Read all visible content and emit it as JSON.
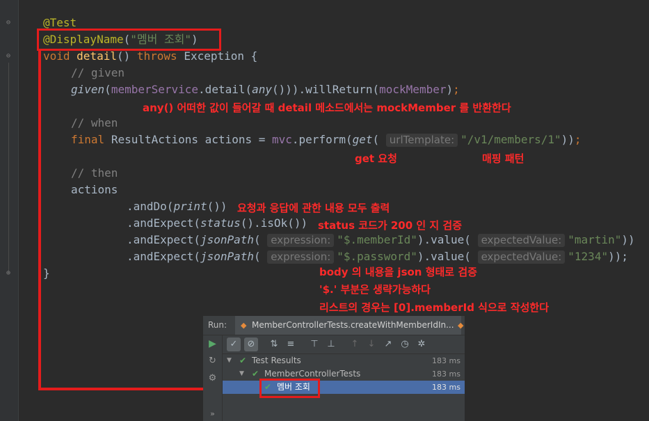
{
  "code": {
    "l1": "@Test",
    "l2_ann": "@DisplayName",
    "l2_str": "\"멤버 조회\"",
    "l3_void": "void",
    "l3_fn": "detail",
    "l3_throws": "throws",
    "l3_exc": "Exception {",
    "l4": "// given",
    "l5_given": "given",
    "l5_service": "memberService",
    "l5_detail": ".detail(",
    "l5_any": "any",
    "l5_rest": "())).willReturn(",
    "l5_mock": "mockMember",
    "l7": "// when",
    "l8_final": "final",
    "l8_type": "ResultActions actions = ",
    "l8_mvc": "mvc",
    "l8_perform": ".perform(",
    "l8_get": "get",
    "l8_hint": "urlTemplate:",
    "l8_str": "\"/v1/members/1\"",
    "l10": "// then",
    "l11": "actions",
    "l12_a": ".andDo(",
    "l12_b": "print",
    "l12_c": "())",
    "l13_a": ".andExpect(",
    "l13_b": "status",
    "l13_c": "().isOk())",
    "l14_a": ".andExpect(",
    "l14_b": "jsonPath",
    "l14_hint": "expression:",
    "l14_str": "\"$.memberId\"",
    "l14_mid": ").value(",
    "l14_hint2": "expectedValue:",
    "l14_val": "\"martin\"",
    "l14_end": "))",
    "l15_str": "\"$.password\"",
    "l15_val": "\"1234\"",
    "l15_end": "));",
    "l16": "}"
  },
  "annotations": {
    "any_note": "any() 어떠한 값이 들어갈 때 detail 메소드에서는 mockMember 를 반환한다",
    "get_note": "get 요청",
    "mapping_note": "매핑 패턴",
    "print_note": "요청과 응답에 관한 내용 모두 출력",
    "status_note": "status 코드가 200 인 지 검증",
    "body_note1": "body 의 내용을 json 형태로 검증",
    "body_note2": "'$.' 부분은 생략가능하다",
    "body_note3": "리스트의 경우는 [0].memberId 식으로 작성한다"
  },
  "run_panel": {
    "label": "Run:",
    "tab_title": "MemberControllerTests.createWithMemberIdIn...",
    "tree": [
      {
        "label": "Test Results",
        "time": "183 ms"
      },
      {
        "label": "MemberControllerTests",
        "time": "183 ms"
      },
      {
        "label": "멤버 조회",
        "time": "183 ms"
      }
    ],
    "more": "»"
  }
}
